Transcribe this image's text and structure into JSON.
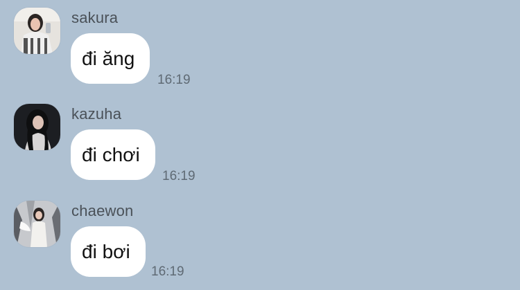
{
  "chat": {
    "background": "#afc1d2",
    "messages": [
      {
        "sender": "sakura",
        "text": "đi ăng",
        "time": "16:19",
        "avatar_icon": "user-avatar-photo"
      },
      {
        "sender": "kazuha",
        "text": "đi chơi",
        "time": "16:19",
        "avatar_icon": "user-avatar-photo"
      },
      {
        "sender": "chaewon",
        "text": "đi bơi",
        "time": "16:19",
        "avatar_icon": "user-avatar-photo"
      }
    ]
  }
}
